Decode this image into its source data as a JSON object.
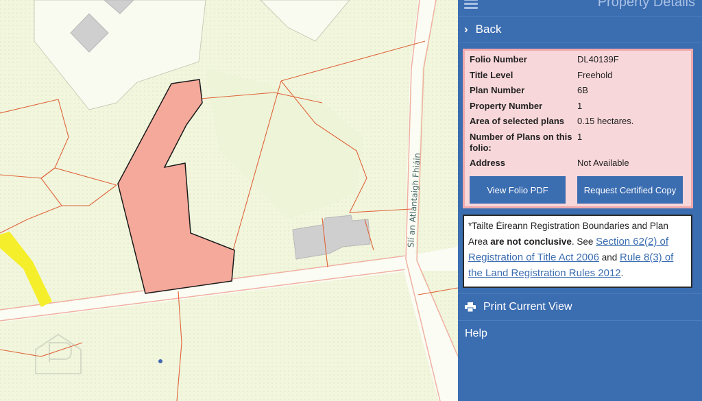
{
  "panel": {
    "title": "Property Details",
    "back_label": "Back"
  },
  "folio": {
    "rows": [
      {
        "label": "Folio Number",
        "value": "DL40139F"
      },
      {
        "label": "Title Level",
        "value": "Freehold"
      },
      {
        "label": "Plan Number",
        "value": "6B"
      },
      {
        "label": "Property Number",
        "value": "1"
      },
      {
        "label": "Area of selected plans",
        "value": "0.15 hectares."
      },
      {
        "label": "Number of Plans on this folio:",
        "value": "1"
      },
      {
        "label": "Address",
        "value": "Not Available"
      }
    ],
    "view_pdf_label": "View Folio PDF",
    "request_copy_label": "Request Certified Copy"
  },
  "notice": {
    "prefix": "*Tailte Éireann Registration Boundaries and Plan Area ",
    "bold": "are not conclusive",
    "mid": ". See ",
    "link1": "Section 62(2) of Registration of Title Act 2006",
    "and": " and ",
    "link2": "Rule 8(3) of the Land Registration Rules 2012",
    "suffix": "."
  },
  "menu": {
    "print_label": "Print Current View",
    "help_label": "Help"
  },
  "map": {
    "road_label": "Slí an Atlantaigh Fhiáin",
    "colors": {
      "background": "#f1f6dd",
      "selected_parcel": "#f5a99a",
      "boundary": "#e0633a",
      "road_edge": "#f0b0a0",
      "building": "#cfcfcf",
      "yellow_road": "#f5ee2a"
    }
  },
  "colors": {
    "panel_bg": "#3b6db1",
    "card_bg": "#f8d7da",
    "card_border": "#f0a9ac"
  }
}
